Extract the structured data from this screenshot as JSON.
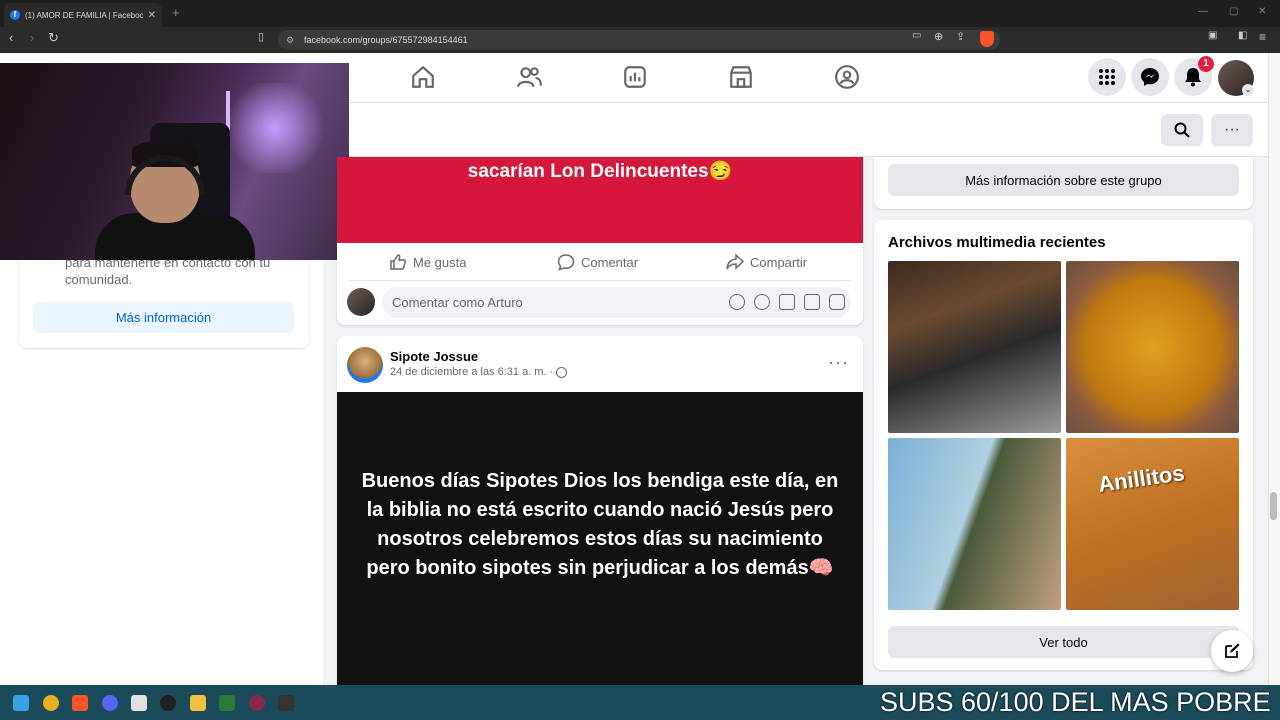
{
  "browser": {
    "tab_title": "(1) AMOR DE FAMILIA | Facebook",
    "url": "facebook.com/groups/675572984154461"
  },
  "header": {
    "notification_count": "1"
  },
  "left": {
    "card_text": "para mantenerte en contacto con tu comunidad.",
    "more_info_button": "Más información"
  },
  "post1": {
    "image_text": "sacarían Lon Delincuentes😏",
    "like_label": "Me gusta",
    "comment_label": "Comentar",
    "share_label": "Compartir",
    "comment_placeholder": "Comentar como Arturo"
  },
  "post2": {
    "author": "Sipote Jossue",
    "date": "24 de diciembre a las 6:31 a. m. ·",
    "text": "Buenos días Sipotes Dios los bendiga este día, en la biblia no está escrito cuando nació Jesús pero nosotros celebremos estos días su nacimiento pero bonito sipotes sin perjudicar a los demás🧠"
  },
  "right": {
    "more_info_group_button": "Más información sobre este grupo",
    "media_title": "Archivos multimedia recientes",
    "media_brand_text": "Anillitos",
    "view_all_button": "Ver todo"
  },
  "overlay": {
    "text": "SUBS 60/100 DEL MAS POBRE"
  },
  "colors": {
    "fb_blue": "#1877f2",
    "post1_bg": "#d6173c",
    "taskbar": "#1b4a5a"
  }
}
